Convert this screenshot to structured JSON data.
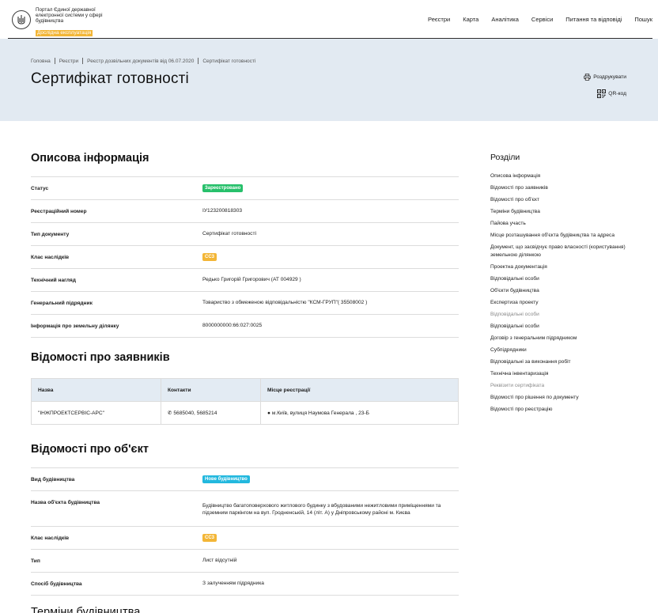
{
  "header": {
    "brand_line1": "Портал Єдиної державної електронної системи у сфері будівництва",
    "beta_label": "Дослідна експлуатація",
    "nav": [
      "Реєстри",
      "Карта",
      "Аналітика",
      "Сервіси",
      "Питання та відповіді",
      "Пошук"
    ]
  },
  "breadcrumbs": [
    "Головна",
    "Реєстри",
    "Реєстр дозвільних документів від 06.07.2020",
    "Сертифікат готовності"
  ],
  "page_title": "Сертифікат готовності",
  "actions": {
    "print": "Роздрукувати",
    "qr": "QR-код"
  },
  "sections": {
    "descriptive": {
      "title": "Описова інформація",
      "rows": [
        {
          "key": "Статус",
          "value": "Зареєстровано"
        },
        {
          "key": "Реєстраційний номер",
          "value": "ІУ123200818303"
        },
        {
          "key": "Тип документу",
          "value": "Сертифікат готовності"
        },
        {
          "key": "Клас наслідків",
          "value": "СС3"
        },
        {
          "key": "Технічний нагляд",
          "value": "Редько Григорій Григорович (АТ 004929 )"
        },
        {
          "key": "Генеральний підрядник",
          "value": "Товариство з обмеженою відповідальністю \"КСМ-ГРУП\"( 35508002 )"
        },
        {
          "key": "Інформація про земельну ділянку",
          "value": "8000000000:66:027:0025"
        }
      ]
    },
    "applicants": {
      "title": "Відомості про заявників",
      "headers": [
        "Назва",
        "Контакти",
        "Місце реєстрації"
      ],
      "row": {
        "name": "\"ІНЖПРОЕКТСЕРВІС-АРС\"",
        "contacts": "5685040, 5685214",
        "place": "м.Київ, вулиця Наумова Генерала , 23-Б"
      }
    },
    "object": {
      "title": "Відомості про об'єкт",
      "rows": [
        {
          "key": "Вид будівництва",
          "value": "Нове будівництво"
        },
        {
          "key": "Назва об'єкта будівництва",
          "value": "Будівництво багатоповерхового житлового будинку з вбудованими нежитловими приміщеннями та підземним паркінгом на вул. Гродненській, 14 (літ. А) у Дніпровському районі м. Києва"
        },
        {
          "key": "Клас наслідків",
          "value": "СС3"
        },
        {
          "key": "Тип",
          "value": "Лист відсутній"
        },
        {
          "key": "Спосіб будівництва",
          "value": "З залученням підрядника"
        }
      ]
    },
    "next_title": "Терміни будівництва"
  },
  "sidebar": {
    "title": "Розділи",
    "items": [
      "Описова інформація",
      "Відомості про заявників",
      "Відомості про об'єкт",
      "Терміни будівництва",
      "Пайова участь",
      "Місце розташування об'єкта будівництва та адреса",
      "Документ, що засвідчує право власності (користування) земельною ділянкою",
      "Проектна документація",
      "Відповідальні особи",
      "Об'єкти будівництва",
      "Експертиза проекту",
      "Відповідальні особи",
      "Відповідальні особи",
      "Договір з генеральним підрядником",
      "Субпідрядники",
      "Відповідальні за виконання робіт",
      "Технічна інвентаризація",
      "Реквізити сертифіката",
      "Відомості про рішення по документу",
      "Відомості про реєстрацію"
    ]
  },
  "colors": {
    "status_green": "#27c06b",
    "class_yellow": "#f3b637",
    "build_blue": "#22b8de",
    "hero_bg": "#e2eaf2"
  }
}
